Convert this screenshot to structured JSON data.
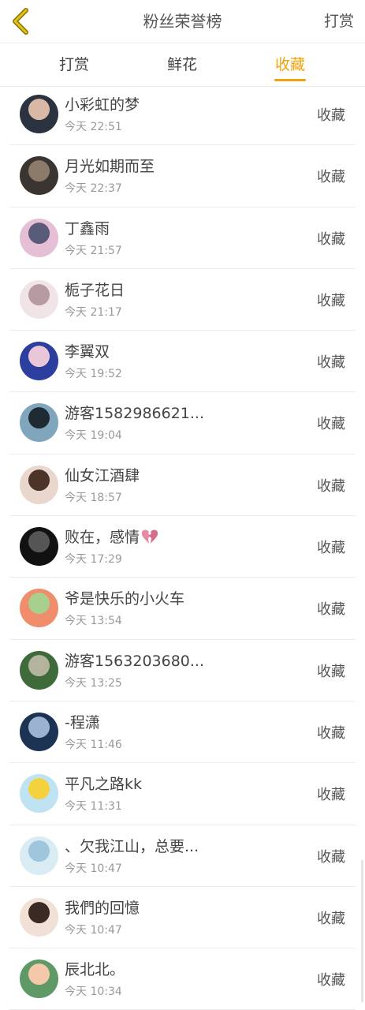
{
  "header": {
    "title": "粉丝荣誉榜",
    "right_label": "打赏"
  },
  "tabs": [
    {
      "label": "打赏",
      "active": false
    },
    {
      "label": "鲜花",
      "active": false
    },
    {
      "label": "收藏",
      "active": true
    }
  ],
  "colors": {
    "accent": "#f0a30a",
    "back_icon": "#d8a400"
  },
  "rows": [
    {
      "name": "小彩虹的梦",
      "time": "今天 22:51",
      "action": "收藏"
    },
    {
      "name": "月光如期而至",
      "time": "今天 22:37",
      "action": "收藏"
    },
    {
      "name": "丁鑫雨",
      "time": "今天 21:57",
      "action": "收藏"
    },
    {
      "name": "栀子花日",
      "time": "今天 21:17",
      "action": "收藏"
    },
    {
      "name": "李翼双",
      "time": "今天 19:52",
      "action": "收藏"
    },
    {
      "name": "游客1582986621...",
      "time": "今天 19:04",
      "action": "收藏"
    },
    {
      "name": "仙女江酒肆",
      "time": "今天 18:57",
      "action": "收藏"
    },
    {
      "name": "败在，感情",
      "time": "今天 17:29",
      "action": "收藏",
      "icon": "broken-heart-icon"
    },
    {
      "name": "爷是快乐的小火车",
      "time": "今天 13:54",
      "action": "收藏"
    },
    {
      "name": "游客1563203680...",
      "time": "今天 13:25",
      "action": "收藏"
    },
    {
      "name": "-程潇",
      "time": "今天 11:46",
      "action": "收藏"
    },
    {
      "name": "平凡之路kk",
      "time": "今天 11:31",
      "action": "收藏"
    },
    {
      "name": "、欠我江山，总要...",
      "time": "今天 10:47",
      "action": "收藏"
    },
    {
      "name": "我們的回憶",
      "time": "今天 10:47",
      "action": "收藏"
    },
    {
      "name": "辰北北。",
      "time": "今天 10:34",
      "action": "收藏"
    }
  ]
}
